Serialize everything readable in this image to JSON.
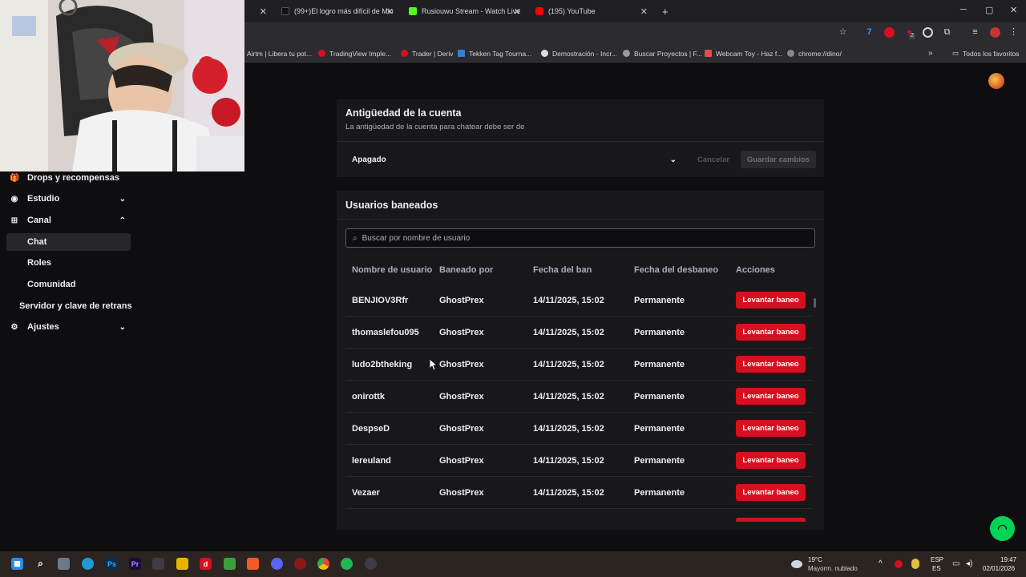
{
  "browser": {
    "tabs": [
      {
        "label": "",
        "close": "✕"
      },
      {
        "label": "(99+)El logro más difícil de Min",
        "close": "✕"
      },
      {
        "label": "Rusiouwu Stream - Watch Live",
        "close": "✕"
      },
      {
        "label": "(195) YouTube",
        "close": "✕"
      }
    ],
    "new_tab": "+",
    "window_controls": {
      "minimize": "─",
      "maximize": "▢",
      "close": "✕"
    },
    "extension_badge": "2",
    "bookmarks": [
      "Airtm | Libera tu pot...",
      "TradingView Imple...",
      "Trader | Deriv",
      "Tekken Tag Tourna...",
      "Demostración - Incr...",
      "Buscar Proyectos | F...",
      "Webcam Toy - Haz f...",
      "chrome://dino/"
    ],
    "bookmarks_more": "»",
    "all_bookmarks": "Todos los favoritos"
  },
  "sidebar": {
    "items": [
      {
        "label": "Drops y recompensas",
        "icon": "gift-icon",
        "glyph": "🎁"
      },
      {
        "label": "Estudio",
        "icon": "studio-icon",
        "glyph": "◉",
        "chevron": "⌄"
      },
      {
        "label": "Canal",
        "icon": "channel-icon",
        "glyph": "⊞",
        "chevron": "⌃"
      },
      {
        "label": "Chat",
        "active": true
      },
      {
        "label": "Roles"
      },
      {
        "label": "Comunidad"
      },
      {
        "label": "Servidor y clave de retrans"
      },
      {
        "label": "Ajustes",
        "icon": "gear-icon",
        "glyph": "⚙",
        "chevron": "⌄"
      }
    ]
  },
  "account_age": {
    "title": "Antigüedad de la cuenta",
    "subtitle": "La antigüedad de la cuenta para chatear debe ser de",
    "select_value": "Apagado",
    "cancel_label": "Cancelar",
    "save_label": "Guardar cambios"
  },
  "banned": {
    "title": "Usuarios baneados",
    "search_placeholder": "Buscar por nombre de usuario",
    "columns": [
      "Nombre de usuario",
      "Baneado por",
      "Fecha del ban",
      "Fecha del desbaneo",
      "Acciones"
    ],
    "action_label": "Levantar baneo",
    "rows": [
      {
        "user": "BENJIOV3Rfr",
        "by": "GhostPrex",
        "date": "14/11/2025, 15:02",
        "unban": "Permanente"
      },
      {
        "user": "thomaslefou095",
        "by": "GhostPrex",
        "date": "14/11/2025, 15:02",
        "unban": "Permanente"
      },
      {
        "user": "ludo2btheking",
        "by": "GhostPrex",
        "date": "14/11/2025, 15:02",
        "unban": "Permanente"
      },
      {
        "user": "onirottk",
        "by": "GhostPrex",
        "date": "14/11/2025, 15:02",
        "unban": "Permanente"
      },
      {
        "user": "DespseD",
        "by": "GhostPrex",
        "date": "14/11/2025, 15:02",
        "unban": "Permanente"
      },
      {
        "user": "lereuland",
        "by": "GhostPrex",
        "date": "14/11/2025, 15:02",
        "unban": "Permanente"
      },
      {
        "user": "Vezaer",
        "by": "GhostPrex",
        "date": "14/11/2025, 15:02",
        "unban": "Permanente"
      }
    ]
  },
  "taskbar": {
    "weather_temp": "19°C",
    "weather_desc": "Mayorm. nublado",
    "lang_top": "ESP",
    "lang_bottom": "ES",
    "time": "19:47",
    "date": "02/01/2026",
    "tray_chevron": "^"
  },
  "colors": {
    "accent_red": "#d70f1f",
    "page_bg": "#0e0e10",
    "panel_bg": "#18181b",
    "help_green": "#00d455"
  }
}
